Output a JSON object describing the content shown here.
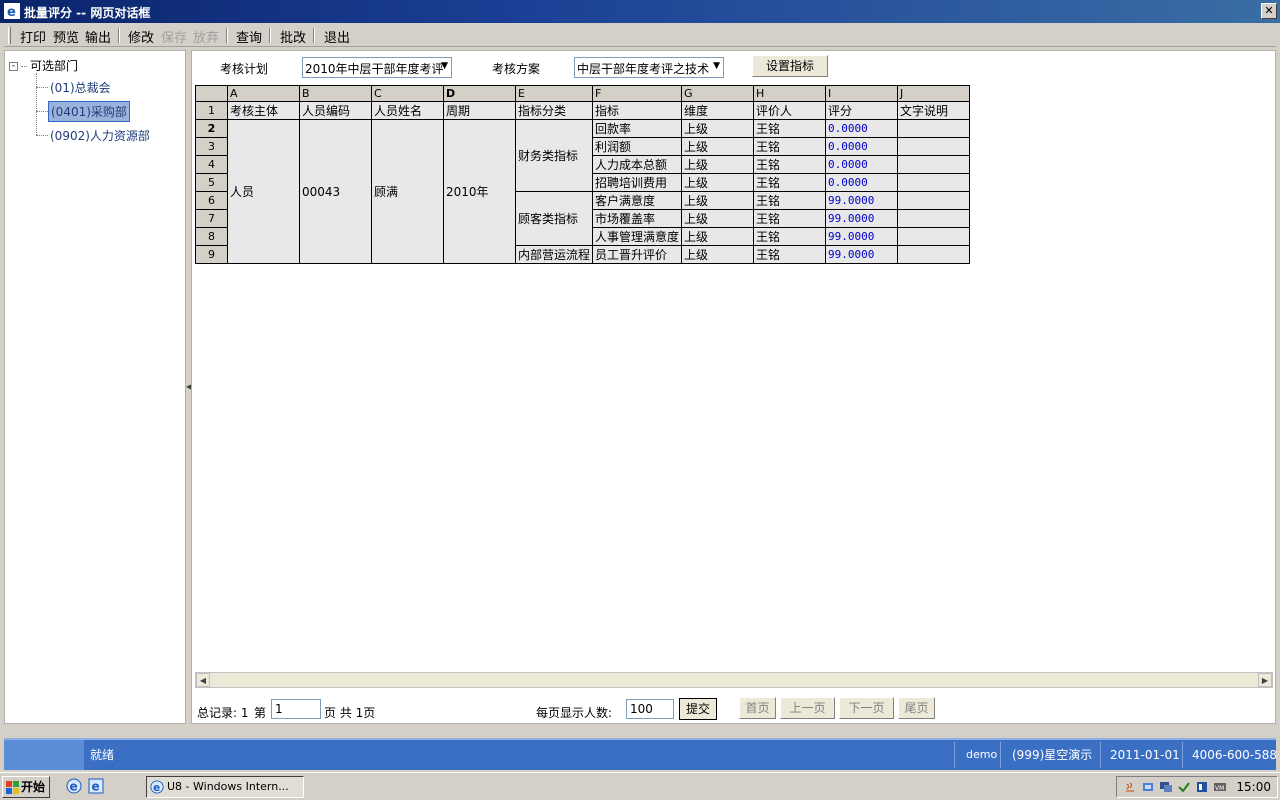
{
  "window": {
    "title": "批量评分 -- 网页对话框",
    "close_label": "✕"
  },
  "menu": [
    {
      "label": "打印",
      "enabled": true
    },
    {
      "label": "预览",
      "enabled": true
    },
    {
      "label": "输出",
      "enabled": true
    },
    {
      "label": "修改",
      "enabled": true
    },
    {
      "label": "保存",
      "enabled": false
    },
    {
      "label": "放弃",
      "enabled": false
    },
    {
      "label": "查询",
      "enabled": true
    },
    {
      "label": "批改",
      "enabled": true
    },
    {
      "label": "退出",
      "enabled": true
    }
  ],
  "tree": {
    "root_label": "可选部门",
    "toggle": "-",
    "nodes": [
      {
        "label": "(01)总裁会",
        "selected": false
      },
      {
        "label": "(0401)采购部",
        "selected": true
      },
      {
        "label": "(0902)人力资源部",
        "selected": false
      }
    ]
  },
  "filters": {
    "plan_label": "考核计划",
    "plan_value": "2010年中层干部年度考评",
    "scheme_label": "考核方案",
    "scheme_value": "中层干部年度考评之技术",
    "set_indicator_button": "设置指标"
  },
  "grid": {
    "columns": [
      "A",
      "B",
      "C",
      "D",
      "E",
      "F",
      "G",
      "H",
      "I",
      "J"
    ],
    "headers": [
      "考核主体",
      "人员编码",
      "人员姓名",
      "周期",
      "指标分类",
      "指标",
      "维度",
      "评价人",
      "评分",
      "文字说明"
    ],
    "subject": "人员",
    "person_code": "00043",
    "person_name": "顾满",
    "period": "2010年",
    "categories": [
      "财务类指标",
      "顾客类指标",
      "内部营运流程"
    ],
    "rows": [
      {
        "num": "2",
        "indicator": "回款率",
        "dimension": "上级",
        "evaluator": "王铭",
        "score": "0.0000",
        "note": ""
      },
      {
        "num": "3",
        "indicator": "利润额",
        "dimension": "上级",
        "evaluator": "王铭",
        "score": "0.0000",
        "note": ""
      },
      {
        "num": "4",
        "indicator": "人力成本总额",
        "dimension": "上级",
        "evaluator": "王铭",
        "score": "0.0000",
        "note": ""
      },
      {
        "num": "5",
        "indicator": "招聘培训费用",
        "dimension": "上级",
        "evaluator": "王铭",
        "score": "0.0000",
        "note": ""
      },
      {
        "num": "6",
        "indicator": "客户满意度",
        "dimension": "上级",
        "evaluator": "王铭",
        "score": "99.0000",
        "note": ""
      },
      {
        "num": "7",
        "indicator": "市场覆盖率",
        "dimension": "上级",
        "evaluator": "王铭",
        "score": "99.0000",
        "note": ""
      },
      {
        "num": "8",
        "indicator": "人事管理满意度",
        "dimension": "上级",
        "evaluator": "王铭",
        "score": "99.0000",
        "note": ""
      },
      {
        "num": "9",
        "indicator": "员工晋升评价",
        "dimension": "上级",
        "evaluator": "王铭",
        "score": "99.0000",
        "note": ""
      }
    ],
    "header_row_num": "1"
  },
  "pager": {
    "total_label": "总记录: 1",
    "page_prefix": "第",
    "page_value": "1",
    "page_suffix": "页 共 1页",
    "per_page_label": "每页显示人数:",
    "per_page_value": "100",
    "submit": "提交",
    "first": "首页",
    "prev": "上一页",
    "next": "下一页",
    "last": "尾页"
  },
  "status": {
    "message": "就绪",
    "user": "demo",
    "account": "(999)星空演示",
    "date": "2011-01-01",
    "phone": "4006-600-588"
  },
  "taskbar": {
    "start": "开始",
    "task_label": "U8 - Windows Intern...",
    "clock": "15:00"
  }
}
